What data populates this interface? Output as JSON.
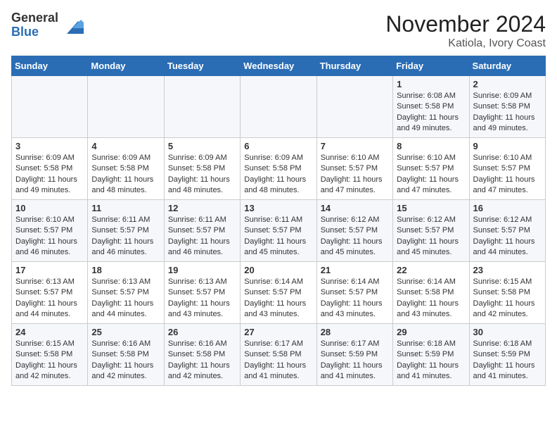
{
  "logo": {
    "general": "General",
    "blue": "Blue"
  },
  "title": "November 2024",
  "location": "Katiola, Ivory Coast",
  "days_of_week": [
    "Sunday",
    "Monday",
    "Tuesday",
    "Wednesday",
    "Thursday",
    "Friday",
    "Saturday"
  ],
  "weeks": [
    [
      {
        "day": "",
        "content": ""
      },
      {
        "day": "",
        "content": ""
      },
      {
        "day": "",
        "content": ""
      },
      {
        "day": "",
        "content": ""
      },
      {
        "day": "",
        "content": ""
      },
      {
        "day": "1",
        "content": "Sunrise: 6:08 AM\nSunset: 5:58 PM\nDaylight: 11 hours and 49 minutes."
      },
      {
        "day": "2",
        "content": "Sunrise: 6:09 AM\nSunset: 5:58 PM\nDaylight: 11 hours and 49 minutes."
      }
    ],
    [
      {
        "day": "3",
        "content": "Sunrise: 6:09 AM\nSunset: 5:58 PM\nDaylight: 11 hours and 49 minutes."
      },
      {
        "day": "4",
        "content": "Sunrise: 6:09 AM\nSunset: 5:58 PM\nDaylight: 11 hours and 48 minutes."
      },
      {
        "day": "5",
        "content": "Sunrise: 6:09 AM\nSunset: 5:58 PM\nDaylight: 11 hours and 48 minutes."
      },
      {
        "day": "6",
        "content": "Sunrise: 6:09 AM\nSunset: 5:58 PM\nDaylight: 11 hours and 48 minutes."
      },
      {
        "day": "7",
        "content": "Sunrise: 6:10 AM\nSunset: 5:57 PM\nDaylight: 11 hours and 47 minutes."
      },
      {
        "day": "8",
        "content": "Sunrise: 6:10 AM\nSunset: 5:57 PM\nDaylight: 11 hours and 47 minutes."
      },
      {
        "day": "9",
        "content": "Sunrise: 6:10 AM\nSunset: 5:57 PM\nDaylight: 11 hours and 47 minutes."
      }
    ],
    [
      {
        "day": "10",
        "content": "Sunrise: 6:10 AM\nSunset: 5:57 PM\nDaylight: 11 hours and 46 minutes."
      },
      {
        "day": "11",
        "content": "Sunrise: 6:11 AM\nSunset: 5:57 PM\nDaylight: 11 hours and 46 minutes."
      },
      {
        "day": "12",
        "content": "Sunrise: 6:11 AM\nSunset: 5:57 PM\nDaylight: 11 hours and 46 minutes."
      },
      {
        "day": "13",
        "content": "Sunrise: 6:11 AM\nSunset: 5:57 PM\nDaylight: 11 hours and 45 minutes."
      },
      {
        "day": "14",
        "content": "Sunrise: 6:12 AM\nSunset: 5:57 PM\nDaylight: 11 hours and 45 minutes."
      },
      {
        "day": "15",
        "content": "Sunrise: 6:12 AM\nSunset: 5:57 PM\nDaylight: 11 hours and 45 minutes."
      },
      {
        "day": "16",
        "content": "Sunrise: 6:12 AM\nSunset: 5:57 PM\nDaylight: 11 hours and 44 minutes."
      }
    ],
    [
      {
        "day": "17",
        "content": "Sunrise: 6:13 AM\nSunset: 5:57 PM\nDaylight: 11 hours and 44 minutes."
      },
      {
        "day": "18",
        "content": "Sunrise: 6:13 AM\nSunset: 5:57 PM\nDaylight: 11 hours and 44 minutes."
      },
      {
        "day": "19",
        "content": "Sunrise: 6:13 AM\nSunset: 5:57 PM\nDaylight: 11 hours and 43 minutes."
      },
      {
        "day": "20",
        "content": "Sunrise: 6:14 AM\nSunset: 5:57 PM\nDaylight: 11 hours and 43 minutes."
      },
      {
        "day": "21",
        "content": "Sunrise: 6:14 AM\nSunset: 5:57 PM\nDaylight: 11 hours and 43 minutes."
      },
      {
        "day": "22",
        "content": "Sunrise: 6:14 AM\nSunset: 5:58 PM\nDaylight: 11 hours and 43 minutes."
      },
      {
        "day": "23",
        "content": "Sunrise: 6:15 AM\nSunset: 5:58 PM\nDaylight: 11 hours and 42 minutes."
      }
    ],
    [
      {
        "day": "24",
        "content": "Sunrise: 6:15 AM\nSunset: 5:58 PM\nDaylight: 11 hours and 42 minutes."
      },
      {
        "day": "25",
        "content": "Sunrise: 6:16 AM\nSunset: 5:58 PM\nDaylight: 11 hours and 42 minutes."
      },
      {
        "day": "26",
        "content": "Sunrise: 6:16 AM\nSunset: 5:58 PM\nDaylight: 11 hours and 42 minutes."
      },
      {
        "day": "27",
        "content": "Sunrise: 6:17 AM\nSunset: 5:58 PM\nDaylight: 11 hours and 41 minutes."
      },
      {
        "day": "28",
        "content": "Sunrise: 6:17 AM\nSunset: 5:59 PM\nDaylight: 11 hours and 41 minutes."
      },
      {
        "day": "29",
        "content": "Sunrise: 6:18 AM\nSunset: 5:59 PM\nDaylight: 11 hours and 41 minutes."
      },
      {
        "day": "30",
        "content": "Sunrise: 6:18 AM\nSunset: 5:59 PM\nDaylight: 11 hours and 41 minutes."
      }
    ]
  ]
}
